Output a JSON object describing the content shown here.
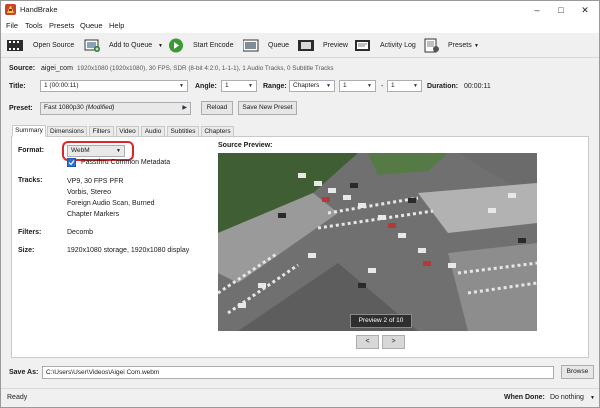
{
  "app": {
    "title": "HandBrake"
  },
  "menu": [
    "File",
    "Tools",
    "Presets",
    "Queue",
    "Help"
  ],
  "toolbar": {
    "open_source": "Open Source",
    "add_to_queue": "Add to Queue",
    "start_encode": "Start Encode",
    "queue": "Queue",
    "preview": "Preview",
    "activity_log": "Activity Log",
    "presets": "Presets"
  },
  "source": {
    "label": "Source:",
    "name": "aigei_com",
    "info": "1920x1080 (1920x1080), 30 FPS, SDR (8-bit 4:2:0, 1-1-1), 1 Audio Tracks, 0 Subtitle Tracks"
  },
  "title_row": {
    "title_label": "Title:",
    "title_value": "1 (00:00:11)",
    "angle_label": "Angle:",
    "angle_value": "1",
    "range_label": "Range:",
    "range_mode": "Chapters",
    "range_start": "1",
    "range_sep": "-",
    "range_end": "1",
    "duration_label": "Duration:",
    "duration_value": "00:00:11"
  },
  "preset": {
    "label": "Preset:",
    "value": "Fast 1080p30",
    "modified": "(Modified)",
    "reload": "Reload",
    "save_new": "Save New Preset"
  },
  "tabs": [
    "Summary",
    "Dimensions",
    "Filters",
    "Video",
    "Audio",
    "Subtitles",
    "Chapters"
  ],
  "summary": {
    "format_label": "Format:",
    "format_value": "WebM",
    "passthru": "Passthru Common Metadata",
    "tracks_label": "Tracks:",
    "tracks": [
      "VP9, 30 FPS PFR",
      "Vorbis, Stereo",
      "Foreign Audio Scan, Burned",
      "Chapter Markers"
    ],
    "filters_label": "Filters:",
    "filters_value": "Decomb",
    "size_label": "Size:",
    "size_value": "1920x1080 storage, 1920x1080 display"
  },
  "preview": {
    "title": "Source Preview:",
    "badge": "Preview 2 of 10",
    "prev": "<",
    "next": ">"
  },
  "save": {
    "label": "Save As:",
    "path": "C:\\Users\\User\\Videos\\Aigei Com.webm",
    "browse": "Browse"
  },
  "status": {
    "text": "Ready",
    "when_done_label": "When Done:",
    "when_done_value": "Do nothing"
  },
  "colors": {
    "accent": "#d9282a",
    "play_green": "#3a9a35"
  }
}
